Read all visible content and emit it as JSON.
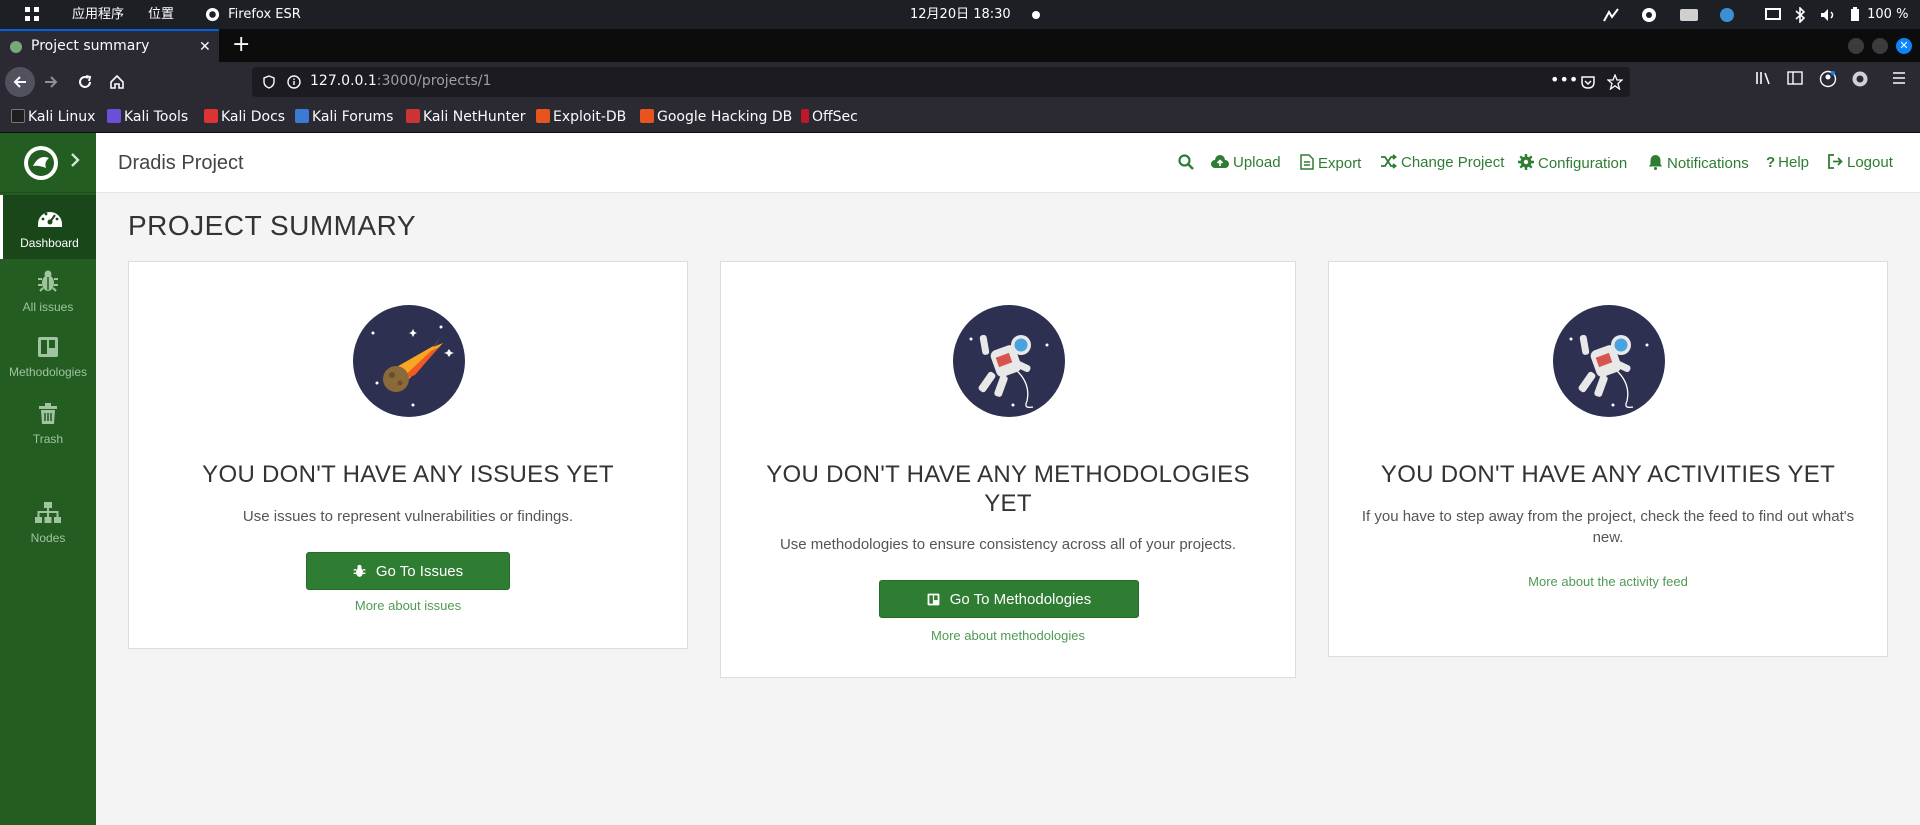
{
  "os": {
    "apps_label": "应用程序",
    "places_label": "位置",
    "browser_label": "Firefox ESR",
    "clock": "12月20日 18:30",
    "battery": "100 %"
  },
  "browser": {
    "tab_title": "Project summary",
    "url_host": "127.0.0.1",
    "url_rest": ":3000/projects/1",
    "bookmarks": [
      "Kali Linux",
      "Kali Tools",
      "Kali Docs",
      "Kali Forums",
      "Kali NetHunter",
      "Exploit-DB",
      "Google Hacking DB",
      "OffSec"
    ]
  },
  "sidebar": {
    "items": [
      {
        "label": "Dashboard",
        "icon": "dashboard-icon"
      },
      {
        "label": "All issues",
        "icon": "bug-icon"
      },
      {
        "label": "Methodologies",
        "icon": "board-icon"
      },
      {
        "label": "Trash",
        "icon": "trash-icon"
      },
      {
        "label": "Nodes",
        "icon": "sitemap-icon"
      }
    ]
  },
  "header": {
    "brand": "Dradis Project",
    "nav": [
      "Upload",
      "Export",
      "Change Project",
      "Configuration",
      "Notifications",
      "Help",
      "Logout"
    ]
  },
  "main": {
    "title": "PROJECT SUMMARY",
    "cards": [
      {
        "heading": "YOU DON'T HAVE ANY ISSUES YET",
        "text": "Use issues to represent vulnerabilities or findings.",
        "button": "Go To Issues",
        "link": "More about issues"
      },
      {
        "heading": "YOU DON'T HAVE ANY METHODOLOGIES YET",
        "text": "Use methodologies to ensure consistency across all of your projects.",
        "button": "Go To Methodologies",
        "link": "More about methodologies"
      },
      {
        "heading": "YOU DON'T HAVE ANY ACTIVITIES YET",
        "text": "If you have to step away from the project, check the feed to find out what's new.",
        "link": "More about the activity feed"
      }
    ]
  },
  "colors": {
    "brand_green": "#2e7d32",
    "sidebar_green": "#235d22",
    "illustration_bg": "#2e3051"
  }
}
